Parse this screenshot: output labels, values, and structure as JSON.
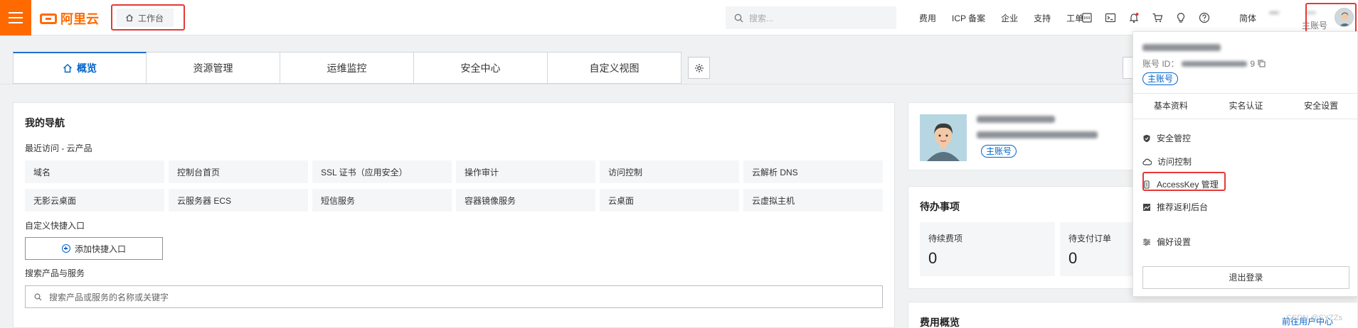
{
  "topbar": {
    "logo_text": "阿里云",
    "workbench_label": "工作台",
    "search_placeholder": "搜索...",
    "links": [
      "费用",
      "ICP 备案",
      "企业",
      "支持",
      "工单"
    ],
    "language": "简体",
    "account_role": "主账号",
    "icons": [
      "hamburger-icon",
      "home-icon",
      "search-icon",
      "icp-icon",
      "terminal-icon",
      "bell-icon",
      "cart-icon",
      "lightbulb-icon",
      "help-icon"
    ]
  },
  "tabs": {
    "items": [
      "概览",
      "资源管理",
      "运维监控",
      "安全中心",
      "自定义视图"
    ],
    "active": "概览"
  },
  "nav_card": {
    "title": "我的导航",
    "recent_label": "最近访问 - 云产品",
    "recent_items": [
      "域名",
      "控制台首页",
      "SSL 证书（应用安全）",
      "操作审计",
      "访问控制",
      "云解析 DNS",
      "无影云桌面",
      "云服务器 ECS",
      "短信服务",
      "容器镜像服务",
      "云桌面",
      "云虚拟主机"
    ],
    "shortcut_label": "自定义快捷入口",
    "add_shortcut": "添加快捷入口",
    "search_label": "搜索产品与服务",
    "search_placeholder": "搜索产品或服务的名称或关键字"
  },
  "profile_card": {
    "badge": "主账号"
  },
  "todo_card": {
    "title": "待办事项",
    "items": [
      {
        "label": "待续费项",
        "value": "0"
      },
      {
        "label": "待支付订单",
        "value": "0"
      }
    ]
  },
  "fee_card": {
    "title": "费用概览",
    "link": "前往用户中心"
  },
  "dropdown": {
    "account_id_label": "账号 ID：",
    "account_id_suffix": "9",
    "badge": "主账号",
    "tabs": [
      "基本资料",
      "实名认证",
      "安全设置"
    ],
    "items": [
      {
        "label": "安全管控",
        "icon": "shield-icon"
      },
      {
        "label": "访问控制",
        "icon": "cloud-icon"
      },
      {
        "label": "AccessKey 管理",
        "icon": "key-icon"
      },
      {
        "label": "推荐返利后台",
        "icon": "gift-icon"
      },
      {
        "label": "偏好设置",
        "icon": "sliders-icon"
      }
    ],
    "logout": "退出登录"
  },
  "watermark": "CSDN @SYZZs",
  "colors": {
    "brand": "#ff6a00",
    "accent": "#0064c8",
    "highlight": "#e53935"
  }
}
